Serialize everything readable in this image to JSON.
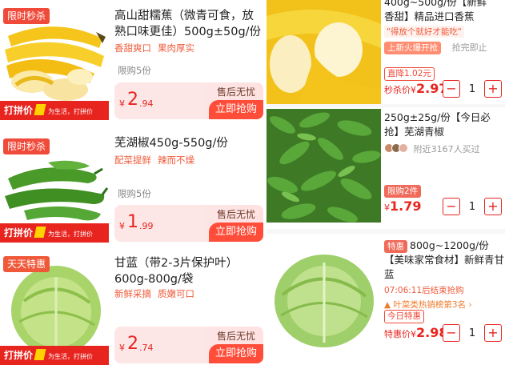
{
  "left": {
    "cards": [
      {
        "badge": "限时秒杀",
        "banner": {
          "main": "打拼价",
          "sub": "为生活，打拼价"
        },
        "title": "高山甜糯蕉（微青可食，放熟口味更佳）500g±50g/份",
        "features": [
          "香甜爽口",
          "果肉厚实"
        ],
        "limit": "限购5份",
        "price": {
          "yen": "¥",
          "int": "2",
          "dec": ".94"
        },
        "after_sales": "售后无忧",
        "buy_label": "立即抢购"
      },
      {
        "badge": "限时秒杀",
        "banner": {
          "main": "打拼价",
          "sub": "为生活，打拼价"
        },
        "title": "芜湖椒450g-550g/份",
        "features": [
          "配菜提鲜",
          "辣而不燥"
        ],
        "limit": "限购5份",
        "price": {
          "yen": "¥",
          "int": "1",
          "dec": ".99"
        },
        "after_sales": "售后无忧",
        "buy_label": "立即抢购"
      },
      {
        "badge": "天天特惠",
        "banner": {
          "main": "打拼价",
          "sub": "为生活，打拼价"
        },
        "title": "甘蓝（带2-3片保护叶）600g-800g/袋",
        "features": [
          "新鲜采摘",
          "质嫩可口"
        ],
        "price": {
          "yen": "¥",
          "int": "2",
          "dec": ".74"
        },
        "after_sales": "售后无忧",
        "buy_label": "立即抢购"
      }
    ]
  },
  "right": {
    "cards": [
      {
        "title_tail": "香甜】精品进口香蕉",
        "title_cut": "400g~500g/份【新鲜",
        "quote": "\"得放个就好才能吃\"",
        "hot_tag": "上新火爆开抢",
        "sold_out_soon": "抢完即止",
        "cut_price_tag": "直降1.02元",
        "price_label": "秒杀价",
        "price": {
          "yen": "¥",
          "num": "2.97"
        },
        "qty": "1",
        "minus": "−",
        "plus": "+"
      },
      {
        "title": "250g±25g/份【今日必抢】芜湖青椒",
        "buyers": "附近3167人买过",
        "limit_tag": "限购2件",
        "price": {
          "yen": "¥",
          "num": "1.79"
        },
        "qty": "1",
        "minus": "−",
        "plus": "+"
      },
      {
        "special_tag": "特惠",
        "title": "800g~1200g/份【美味家常食材】新鲜青甘蓝",
        "countdown": "07:06:11后结束抢购",
        "rank": "叶菜类热销榜第3名",
        "rank_arrow": "›",
        "today_tag": "今日特惠",
        "price_label": "特惠价",
        "price": {
          "yen": "¥",
          "num": "2.98"
        },
        "qty": "1",
        "minus": "−",
        "plus": "+"
      }
    ]
  },
  "colors": {
    "accent": "#e8241f",
    "badge": "#f04a3a",
    "buy": "#ff4d3a",
    "price_bg": "#fde6e6"
  }
}
